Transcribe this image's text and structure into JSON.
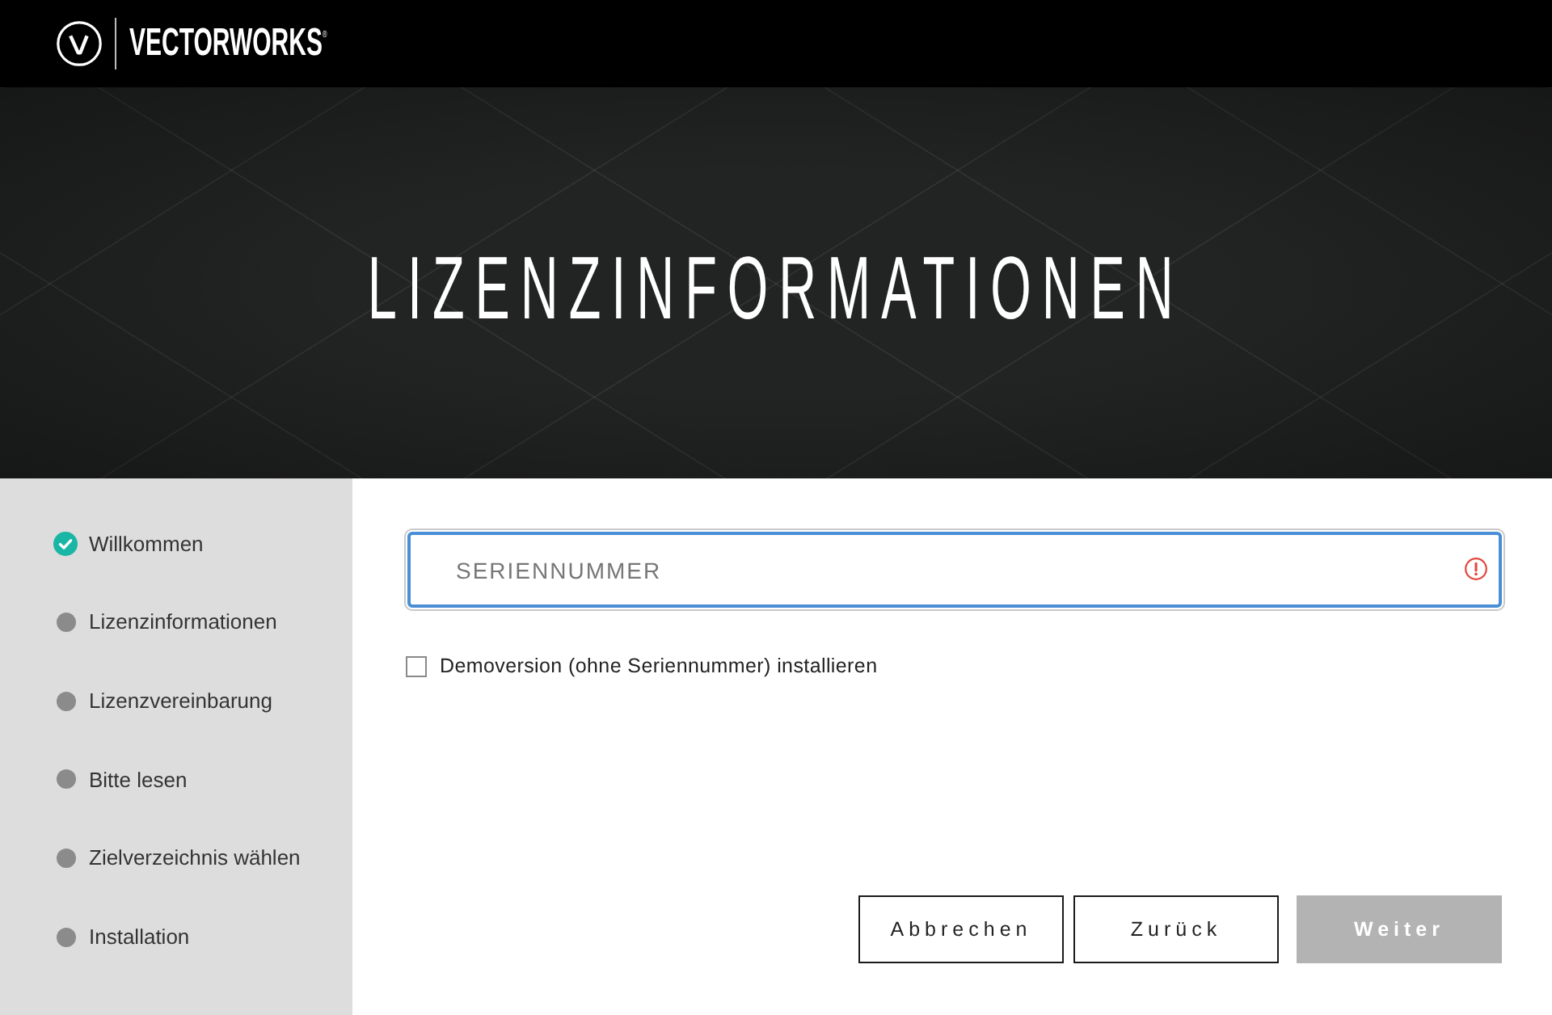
{
  "header": {
    "brand": "VECTORWORKS$^{®}$"
  },
  "hero": {
    "title": "LIZENZINFORMATIONEN"
  },
  "steps": [
    {
      "label": "Willkommen",
      "done": true
    },
    {
      "label": "Lizenzinformationen",
      "done": false
    },
    {
      "label": "Lizenzvereinbarung",
      "done": false
    },
    {
      "label": "Bitte lesen",
      "done": false
    },
    {
      "label": "Zielverzeichnis wählen",
      "done": false
    },
    {
      "label": "Installation",
      "done": false
    }
  ],
  "serial_field": {
    "placeholder": "SERIENNUMMER",
    "focused": true,
    "error": true
  },
  "demo_checkbox": {
    "label": "Demoversion (ohne Seriennummer) installieren",
    "checked": false
  },
  "buttons": [
    {
      "label": "Abbrechen",
      "kind": "secondary",
      "disabled": false
    },
    {
      "label": "Zurück",
      "kind": "secondary",
      "disabled": false
    },
    {
      "label": "Weiter",
      "kind": "primary",
      "disabled": true
    }
  ]
}
